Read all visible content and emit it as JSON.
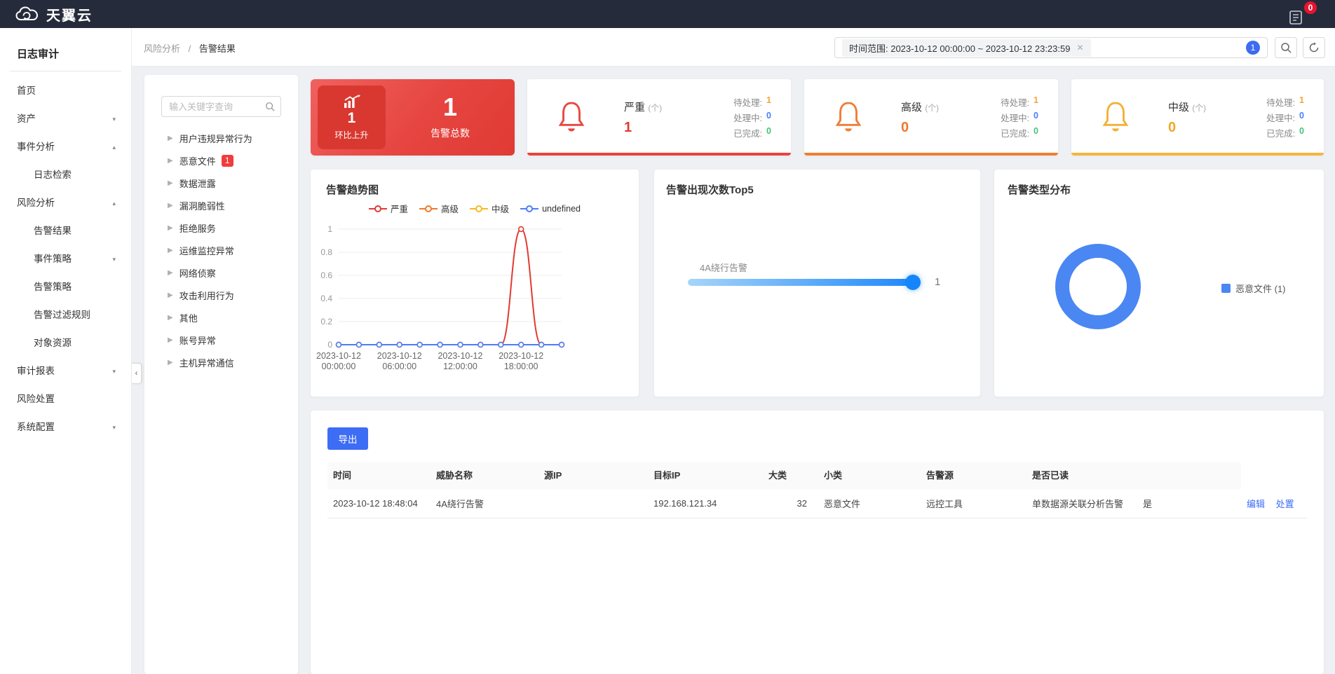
{
  "navbar": {
    "brand": "天翼云",
    "notification_count": "0"
  },
  "sidebar": {
    "title": "日志审计",
    "items": [
      {
        "label": "首页",
        "indent": false,
        "caret": ""
      },
      {
        "label": "资产",
        "indent": false,
        "caret": "▾"
      },
      {
        "label": "事件分析",
        "indent": false,
        "caret": "▴"
      },
      {
        "label": "日志检索",
        "indent": true,
        "caret": ""
      },
      {
        "label": "风险分析",
        "indent": false,
        "caret": "▴"
      },
      {
        "label": "告警结果",
        "indent": true,
        "caret": ""
      },
      {
        "label": "事件策略",
        "indent": true,
        "caret": "▾"
      },
      {
        "label": "告警策略",
        "indent": true,
        "caret": ""
      },
      {
        "label": "告警过滤规则",
        "indent": true,
        "caret": ""
      },
      {
        "label": "对象资源",
        "indent": true,
        "caret": ""
      },
      {
        "label": "审计报表",
        "indent": false,
        "caret": "▾"
      },
      {
        "label": "风险处置",
        "indent": false,
        "caret": ""
      },
      {
        "label": "系统配置",
        "indent": false,
        "caret": "▾"
      }
    ]
  },
  "breadcrumb": {
    "parent": "风险分析",
    "separator": "/",
    "current": "告警结果"
  },
  "topbar": {
    "time_filter": "时间范围: 2023-10-12 00:00:00 ~ 2023-10-12 23:23:59",
    "filter_count": "1"
  },
  "tree": {
    "search_placeholder": "输入关键字查询",
    "items": [
      {
        "label": "用户违规异常行为",
        "badge": ""
      },
      {
        "label": "恶意文件",
        "badge": "1"
      },
      {
        "label": "数据泄露",
        "badge": ""
      },
      {
        "label": "漏洞脆弱性",
        "badge": ""
      },
      {
        "label": "拒绝服务",
        "badge": ""
      },
      {
        "label": "运维监控异常",
        "badge": ""
      },
      {
        "label": "网络侦察",
        "badge": ""
      },
      {
        "label": "攻击利用行为",
        "badge": ""
      },
      {
        "label": "其他",
        "badge": ""
      },
      {
        "label": "账号异常",
        "badge": ""
      },
      {
        "label": "主机异常通信",
        "badge": ""
      }
    ]
  },
  "summary": {
    "total": {
      "trend_value": "1",
      "trend_label": "环比上升",
      "value": "1",
      "label": "告警总数"
    },
    "levels": [
      {
        "name": "严重",
        "unit": "(个)",
        "value": "1",
        "accent": "#e8443c",
        "stats": [
          {
            "label": "待处理:",
            "value": "1"
          },
          {
            "label": "处理中:",
            "value": "0"
          },
          {
            "label": "已完成:",
            "value": "0"
          }
        ]
      },
      {
        "name": "高级",
        "unit": "(个)",
        "value": "0",
        "accent": "#ee7e33",
        "stats": [
          {
            "label": "待处理:",
            "value": "1"
          },
          {
            "label": "处理中:",
            "value": "0"
          },
          {
            "label": "已完成:",
            "value": "0"
          }
        ]
      },
      {
        "name": "中级",
        "unit": "(个)",
        "value": "0",
        "accent": "#f3b43e",
        "stats": [
          {
            "label": "待处理:",
            "value": "1"
          },
          {
            "label": "处理中:",
            "value": "0"
          },
          {
            "label": "已完成:",
            "value": "0"
          }
        ]
      }
    ]
  },
  "chart_data": [
    {
      "type": "line",
      "title": "告警趋势图",
      "x": [
        "2023-10-12 00:00:00",
        "2023-10-12 02:00:00",
        "2023-10-12 04:00:00",
        "2023-10-12 06:00:00",
        "2023-10-12 08:00:00",
        "2023-10-12 10:00:00",
        "2023-10-12 12:00:00",
        "2023-10-12 14:00:00",
        "2023-10-12 16:00:00",
        "2023-10-12 18:00:00",
        "2023-10-12 20:00:00",
        "2023-10-12 22:00:00"
      ],
      "tick_indices": [
        0,
        3,
        6,
        9
      ],
      "series": [
        {
          "name": "严重",
          "color": "#e23a32",
          "values": [
            0,
            0,
            0,
            0,
            0,
            0,
            0,
            0,
            0,
            1,
            0,
            0
          ]
        },
        {
          "name": "高级",
          "color": "#f07a29",
          "values": [
            0,
            0,
            0,
            0,
            0,
            0,
            0,
            0,
            0,
            0,
            0,
            0
          ]
        },
        {
          "name": "中级",
          "color": "#f5bb1f",
          "values": [
            0,
            0,
            0,
            0,
            0,
            0,
            0,
            0,
            0,
            0,
            0,
            0
          ]
        },
        {
          "name": "undefined",
          "color": "#4f7df9",
          "values": [
            0,
            0,
            0,
            0,
            0,
            0,
            0,
            0,
            0,
            0,
            0,
            0
          ]
        }
      ],
      "ylim": [
        0,
        1
      ],
      "yticks": [
        0,
        0.2,
        0.4,
        0.6,
        0.8,
        1
      ],
      "grid": true,
      "legend_position": "top",
      "smooth": true
    },
    {
      "type": "bar",
      "orientation": "horizontal",
      "title": "告警出现次数Top5",
      "categories": [
        "4A绕行告警"
      ],
      "values": [
        1
      ],
      "xlim": [
        0,
        1
      ],
      "bar_gradient": [
        "#a6d5f9",
        "#1b86fb"
      ]
    },
    {
      "type": "pie",
      "title": "告警类型分布",
      "labels": [
        "恶意文件"
      ],
      "values": [
        1
      ],
      "colors": [
        "#4a87f3"
      ],
      "legend": [
        "恶意文件 (1)"
      ],
      "legend_position": "right",
      "donut": true
    }
  ],
  "table": {
    "export_label": "导出",
    "columns": [
      "时间",
      "威胁名称",
      "源IP",
      "目标IP",
      "大类",
      "小类",
      "告警源",
      "是否已读",
      "",
      ""
    ],
    "rows": [
      {
        "cells": [
          "2023-10-12 18:48:04",
          "4A绕行告警",
          "",
          "192.168.121.34",
          "32",
          "恶意文件",
          "远控工具",
          "单数据源关联分析告警",
          "是"
        ],
        "actions": [
          "编辑",
          "处置"
        ]
      }
    ]
  },
  "colors": {
    "navbar_bg": "#252b3a",
    "page_bg": "#eef0f4",
    "primary_blue": "#3d6df5",
    "severe_red": "#e23a32",
    "high_orange": "#f07a29",
    "mid_gold": "#f3b43e",
    "pending_orange": "#f5a43b",
    "doing_blue": "#4a7dff",
    "done_green": "#42c57a",
    "badge_red": "#f23c3c",
    "total_card_gradient": [
      "#f0625e",
      "#e03a34"
    ]
  }
}
